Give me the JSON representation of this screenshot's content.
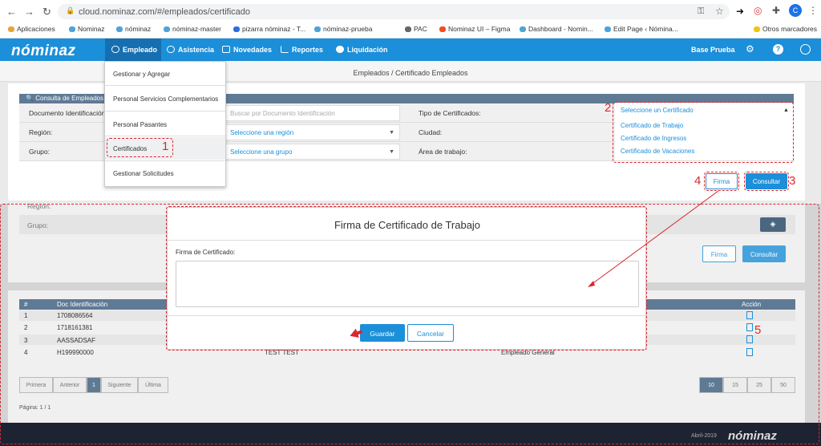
{
  "browser": {
    "url": "cloud.nominaz.com/#/empleados/certificado",
    "bookmarks": [
      "Aplicaciones",
      "Nominaz",
      "nóminaz",
      "nóminaz-master",
      "pizarra nóminaz - T...",
      "nóminaz-prueba",
      "PAC",
      "Nominaz UI – Figma",
      "Dashboard - Nomin...",
      "Edit Page ‹ Nómina...",
      "Otros marcadores"
    ],
    "profile_initial": "C"
  },
  "nav": {
    "logo": "nóminaz",
    "items": [
      "Empleado",
      "Asistencia",
      "Novedades",
      "Reportes",
      "Liquidación"
    ],
    "user": "Base Prueba"
  },
  "breadcrumb": "Empleados / Certificado Empleados",
  "panel": {
    "title": "Consulta de Empleados",
    "doc_label": "Documento Identificación:",
    "doc_placeholder": "Buscar por Documento Identificación",
    "region_label": "Región:",
    "region_value": "Seleccione una región",
    "grupo_label": "Grupo:",
    "grupo_value": "Seleccione una grupo",
    "tipo_label": "Tipo de Certificados:",
    "ciudad_label": "Ciudad:",
    "area_label": "Área de trabajo:"
  },
  "dropdown_menu": [
    "Gestionar y Agregar",
    "Personal Servicios Complementarios",
    "Personal Pasantes",
    "Certificados",
    "Gestionar Solicitudes"
  ],
  "cert_select": {
    "placeholder": "Seleccione un Certificado",
    "options": [
      "Certificado de Trabajo",
      "Certificado de Ingresos",
      "Certificado de Vacaciones"
    ]
  },
  "buttons": {
    "firma": "Firma",
    "consultar": "Consultar"
  },
  "background": {
    "region_label": "Región:",
    "grupo_label": "Grupo:",
    "table_headers": [
      "#",
      "Doc Identificación",
      "Acción"
    ],
    "rows": [
      {
        "n": "1",
        "doc": "1708086564",
        "name": "",
        "role": ""
      },
      {
        "n": "2",
        "doc": "1718161381",
        "name": "",
        "role": ""
      },
      {
        "n": "3",
        "doc": "AASSADSAF",
        "name": "",
        "role": ""
      },
      {
        "n": "4",
        "doc": "H199990000",
        "name": "TEST TEST",
        "role": "Empleado General"
      }
    ],
    "pagination": [
      "Primera",
      "Anterior",
      "1",
      "Siguiente",
      "Última"
    ],
    "page_sizes": [
      "10",
      "15",
      "25",
      "50"
    ],
    "page_info": "Página: 1 / 1",
    "footer_date": "Abril-2019",
    "footer_logo": "nóminaz"
  },
  "modal": {
    "title": "Firma de Certificado de Trabajo",
    "field_label": "Firma de Certificado:",
    "save": "Guardar",
    "cancel": "Cancelar"
  },
  "annotations": [
    "1",
    "2",
    "3",
    "4",
    "5"
  ],
  "colors": {
    "primary": "#1b8fd9",
    "annotation": "#d9282f",
    "footer": "#1d2330"
  }
}
